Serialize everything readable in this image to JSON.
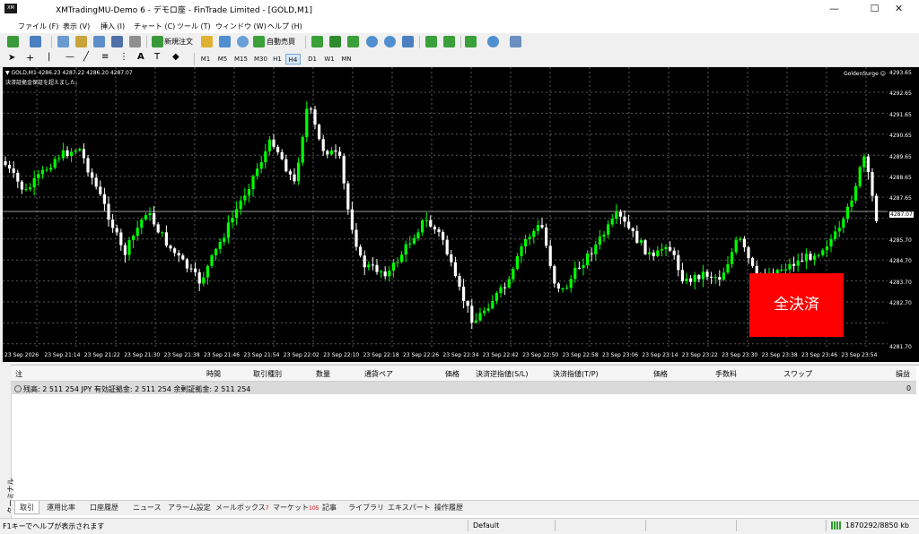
{
  "window": {
    "title": "XMTradingMU-Demo 6 - デモロ座 - FinTrade Limited - [GOLD,M1]",
    "app_icon": "XM",
    "minimize": "—",
    "maximize": "☐",
    "close": "✕"
  },
  "menu": [
    "ファイル (F)",
    "表示 (V)",
    "挿入 (I)",
    "チャート (C)",
    "ツール (T)",
    "ウィンドウ (W)",
    "ヘルプ (H)"
  ],
  "toolbar": {
    "new_order": "新規注文",
    "auto_trading": "自動売買",
    "notification_count": "1"
  },
  "timeframes": [
    "M1",
    "M5",
    "M15",
    "M30",
    "H1",
    "H4",
    "D1",
    "W1",
    "MN"
  ],
  "active_timeframe": "H4",
  "chart": {
    "symbol_info": "▼ GOLD,M1  4286.23 4287.22 4286.20 4287.07",
    "warning": "決済証拠金保証を超えました。",
    "ea_name": "GoldenSurge ☺",
    "close_all_label": "全決済",
    "current_price": "4287.07",
    "price_labels": [
      "4293.65",
      "4292.65",
      "4291.65",
      "4290.65",
      "4289.65",
      "4288.65",
      "4287.65",
      "4287.07",
      "4285.70",
      "4284.70",
      "4283.70",
      "4282.70",
      "4281.70"
    ],
    "time_labels": [
      "23 Sep 2026",
      "23 Sep 21:14",
      "23 Sep 21:22",
      "23 Sep 21:30",
      "23 Sep 21:38",
      "23 Sep 21:46",
      "23 Sep 21:54",
      "23 Sep 22:02",
      "23 Sep 22:10",
      "23 Sep 22:18",
      "23 Sep 22:26",
      "23 Sep 22:34",
      "23 Sep 22:42",
      "23 Sep 22:50",
      "23 Sep 22:58",
      "23 Sep 23:06",
      "23 Sep 23:14",
      "23 Sep 23:22",
      "23 Sep 23:30",
      "23 Sep 23:38",
      "23 Sep 23:46",
      "23 Sep 23:54"
    ],
    "colors": {
      "bull": "#00ff00",
      "bear": "#ffffff",
      "background": "#000000",
      "grid": "#5a5a5a",
      "button": "#ff0000"
    }
  },
  "terminal": {
    "side_label": "ターミナル",
    "columns": [
      "注",
      "時間",
      "取引種別",
      "数量",
      "通貨ペア",
      "価格",
      "決済逆指値(S/L)",
      "決済指値(T/P)",
      "価格",
      "手数料",
      "スワップ",
      "損益"
    ],
    "balance_text": "残高: 2 511 254 JPY  有効証拠金: 2 511 254  余剰証拠金: 2 511 254",
    "balance_value": "0",
    "tabs": [
      {
        "label": "取引",
        "badge": ""
      },
      {
        "label": "運用比率",
        "badge": ""
      },
      {
        "label": "口座履歴",
        "badge": ""
      },
      {
        "label": "ニュース",
        "badge": ""
      },
      {
        "label": "アラーム設定",
        "badge": ""
      },
      {
        "label": "メールボックス",
        "badge": "7"
      },
      {
        "label": "マーケット",
        "badge": "105"
      },
      {
        "label": "記事",
        "badge": ""
      },
      {
        "label": "ライブラリ",
        "badge": ""
      },
      {
        "label": "エキスパート",
        "badge": ""
      },
      {
        "label": "操作履歴",
        "badge": ""
      }
    ]
  },
  "status": {
    "help": "F1キーでヘルプが表示されます",
    "profile": "Default",
    "traffic": "1870292/8850 kb"
  }
}
